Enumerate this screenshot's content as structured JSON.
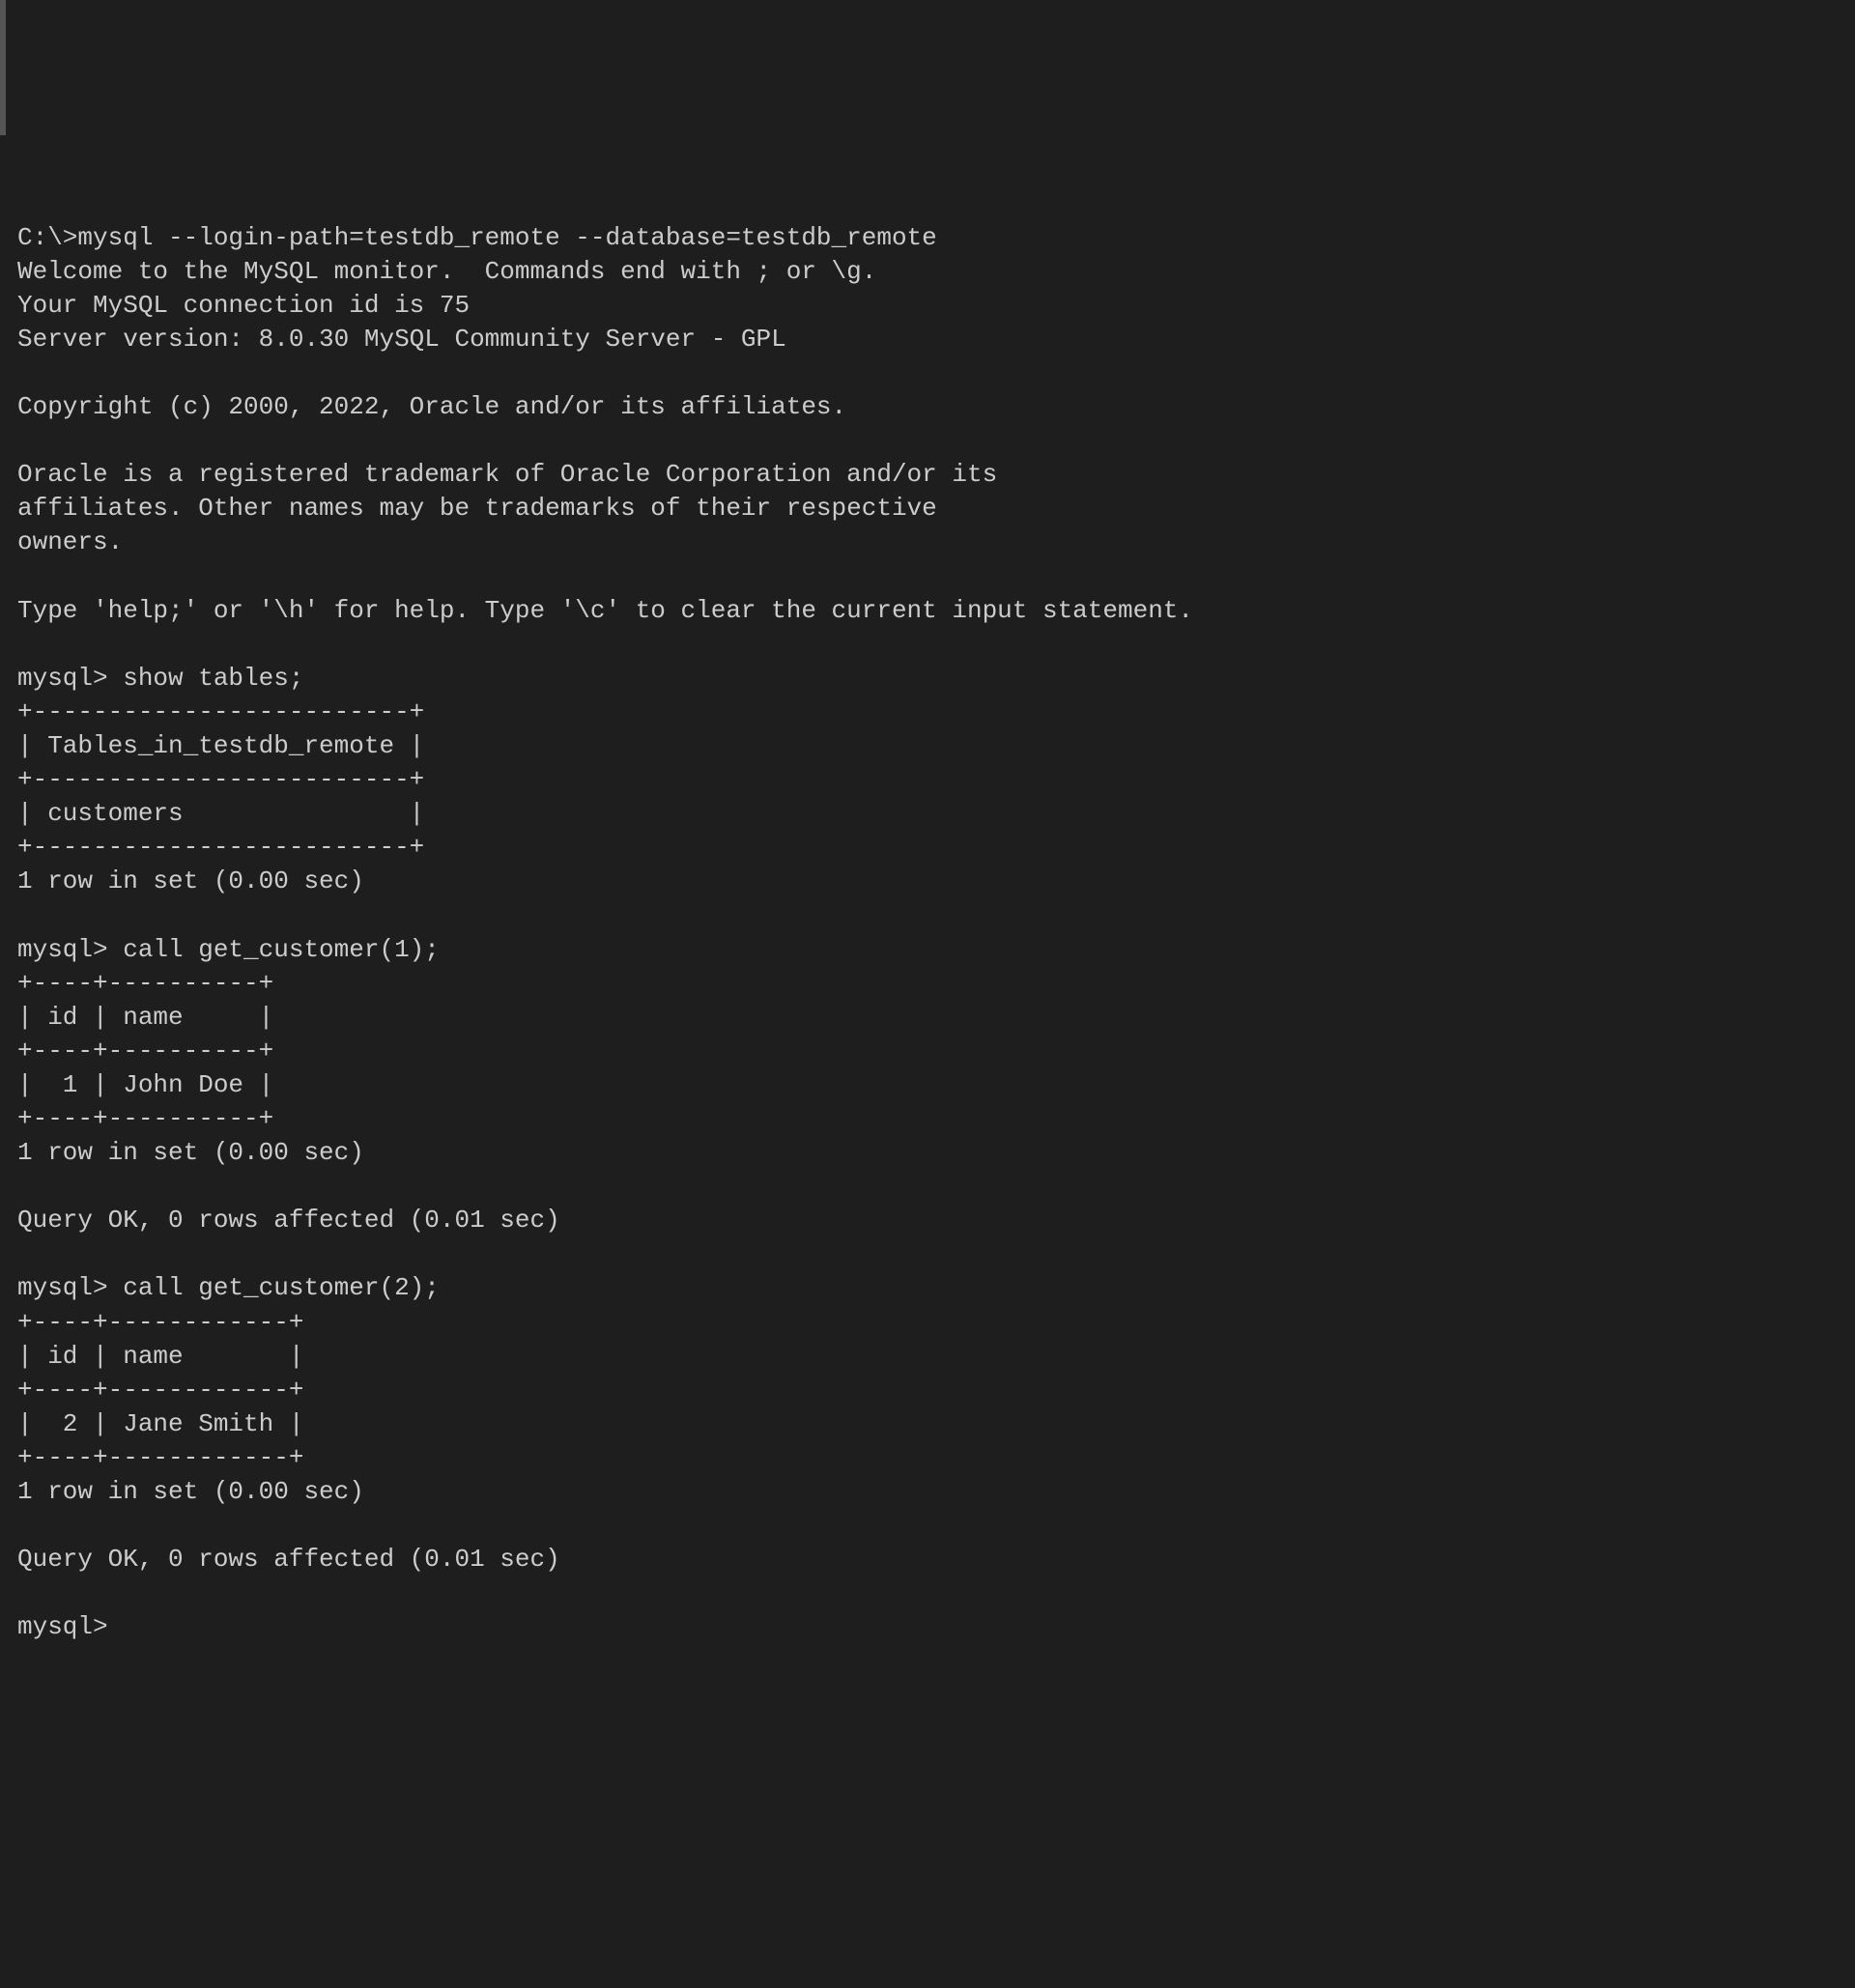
{
  "terminal": {
    "lines": [
      "C:\\>mysql --login-path=testdb_remote --database=testdb_remote",
      "Welcome to the MySQL monitor.  Commands end with ; or \\g.",
      "Your MySQL connection id is 75",
      "Server version: 8.0.30 MySQL Community Server - GPL",
      "",
      "Copyright (c) 2000, 2022, Oracle and/or its affiliates.",
      "",
      "Oracle is a registered trademark of Oracle Corporation and/or its",
      "affiliates. Other names may be trademarks of their respective",
      "owners.",
      "",
      "Type 'help;' or '\\h' for help. Type '\\c' to clear the current input statement.",
      "",
      "mysql> show tables;",
      "+-------------------------+",
      "| Tables_in_testdb_remote |",
      "+-------------------------+",
      "| customers               |",
      "+-------------------------+",
      "1 row in set (0.00 sec)",
      "",
      "mysql> call get_customer(1);",
      "+----+----------+",
      "| id | name     |",
      "+----+----------+",
      "|  1 | John Doe |",
      "+----+----------+",
      "1 row in set (0.00 sec)",
      "",
      "Query OK, 0 rows affected (0.01 sec)",
      "",
      "mysql> call get_customer(2);",
      "+----+------------+",
      "| id | name       |",
      "+----+------------+",
      "|  2 | Jane Smith |",
      "+----+------------+",
      "1 row in set (0.00 sec)",
      "",
      "Query OK, 0 rows affected (0.01 sec)",
      "",
      "mysql>"
    ]
  }
}
